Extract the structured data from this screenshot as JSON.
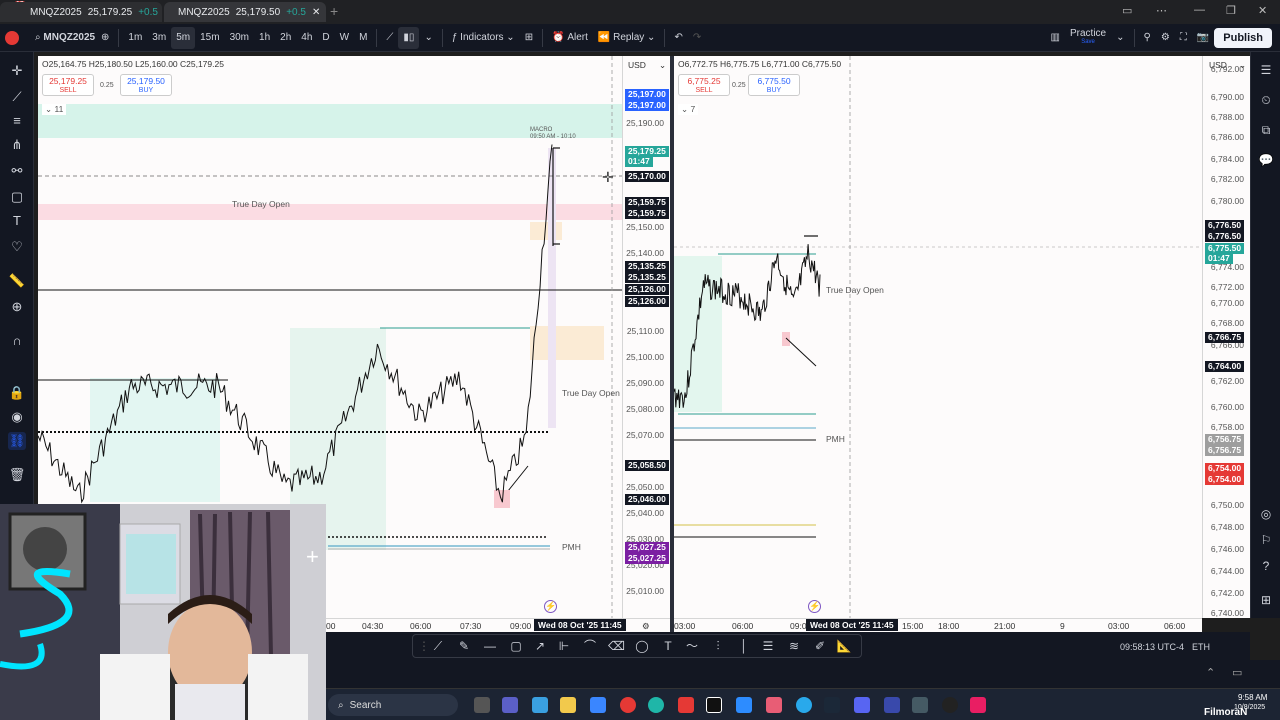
{
  "browser": {
    "tabs": [
      {
        "symbol": "MNQZ2025",
        "price": "25,179.25",
        "chg": "+0.5"
      },
      {
        "symbol": "MNQZ2025",
        "price": "25,179.50",
        "chg": "+0.5"
      }
    ],
    "new_tab": "+",
    "badge": "12"
  },
  "toolbar": {
    "symbol": "MNQZ2025",
    "intervals": [
      "1m",
      "3m",
      "5m",
      "15m",
      "30m",
      "1h",
      "2h",
      "4h",
      "D",
      "W",
      "M"
    ],
    "selected_interval": "5m",
    "indicators": "Indicators",
    "alert": "Alert",
    "replay": "Replay",
    "practice": "Practice",
    "practice_sub": "Save",
    "publish": "Publish"
  },
  "chart_left": {
    "ohlc": "O25,164.75 H25,180.50 L25,160.00 C25,179.25",
    "currency": "USD",
    "sell_price": "25,179.25",
    "sell_label": "SELL",
    "spread": "0.25",
    "buy_price": "25,179.50",
    "buy_label": "BUY",
    "indicator_count": "11",
    "axis_labels": [
      "25,190.00",
      "25,150.00",
      "25,140.00",
      "25,110.00",
      "25,100.00",
      "25,090.00",
      "25,080.00",
      "25,070.00",
      "25,050.00",
      "25,040.00",
      "25,030.00",
      "25,020.00",
      "25,010.00"
    ],
    "tags": [
      {
        "text": "25,197.00",
        "color": "#2962ff"
      },
      {
        "text": "25,197.00",
        "color": "#2962ff"
      },
      {
        "text": "25,179.25",
        "color": "#26a69a"
      },
      {
        "text": "01:47",
        "color": "#26a69a"
      },
      {
        "text": "25,170.00",
        "color": "#131722"
      },
      {
        "text": "25,159.75",
        "color": "#131722"
      },
      {
        "text": "25,159.75",
        "color": "#131722"
      },
      {
        "text": "25,135.25",
        "color": "#131722"
      },
      {
        "text": "25,135.25",
        "color": "#131722"
      },
      {
        "text": "25,126.00",
        "color": "#131722"
      },
      {
        "text": "25,126.00",
        "color": "#131722"
      },
      {
        "text": "25,058.50",
        "color": "#131722"
      },
      {
        "text": "25,046.00",
        "color": "#131722"
      },
      {
        "text": "25,027.25",
        "color": "#7b1fa2"
      },
      {
        "text": "25,027.25",
        "color": "#7b1fa2"
      }
    ],
    "labels": {
      "tdo_top": "True Day Open",
      "tdo_mid": "True Day Open",
      "pmh": "PMH",
      "macro": "MACRO",
      "macro_time": "09:50 AM - 10:10"
    },
    "time_labels": [
      "00",
      "04:30",
      "06:00",
      "07:30",
      "09:00"
    ],
    "time_cursor": "Wed 08 Oct '25  11:45"
  },
  "chart_right": {
    "ohlc": "O6,772.75 H6,775.75 L6,771.00 C6,775.50",
    "currency": "USD",
    "sell_price": "6,775.25",
    "sell_label": "SELL",
    "spread": "0.25",
    "buy_price": "6,775.50",
    "buy_label": "BUY",
    "indicator_count": "7",
    "axis_labels": [
      "6,792.00",
      "6,790.00",
      "6,788.00",
      "6,786.00",
      "6,784.00",
      "6,782.00",
      "6,780.00",
      "6,778.00",
      "6,774.00",
      "6,772.00",
      "6,770.00",
      "6,768.00",
      "6,766.00",
      "6,762.00",
      "6,760.00",
      "6,758.00",
      "6,752.00",
      "6,750.00",
      "6,748.00",
      "6,746.00",
      "6,744.00",
      "6,742.00",
      "6,740.00"
    ],
    "tags": [
      {
        "text": "6,776.50",
        "color": "#131722"
      },
      {
        "text": "6,776.50",
        "color": "#131722"
      },
      {
        "text": "6,775.50",
        "color": "#26a69a"
      },
      {
        "text": "01:47",
        "color": "#26a69a"
      },
      {
        "text": "6,766.75",
        "color": "#131722"
      },
      {
        "text": "6,764.00",
        "color": "#131722"
      },
      {
        "text": "6,756.75",
        "color": "#9e9e9e"
      },
      {
        "text": "6,756.75",
        "color": "#9e9e9e"
      },
      {
        "text": "6,754.00",
        "color": "#e53935"
      },
      {
        "text": "6,754.00",
        "color": "#e53935"
      }
    ],
    "labels": {
      "tdo": "True Day Open",
      "pmh": "PMH"
    },
    "time_labels": [
      "03:00",
      "06:00",
      "09:00",
      "15:00",
      "18:00",
      "21:00",
      "9",
      "03:00",
      "06:00"
    ],
    "time_cursor": "Wed 08 Oct '25  11:45"
  },
  "status": {
    "clock": "09:58:13 UTC-4",
    "session": "ETH"
  },
  "taskbar": {
    "search": "Search",
    "time": "9:58 AM",
    "date": "10/8/2025",
    "watermark": "FilmoraN"
  }
}
